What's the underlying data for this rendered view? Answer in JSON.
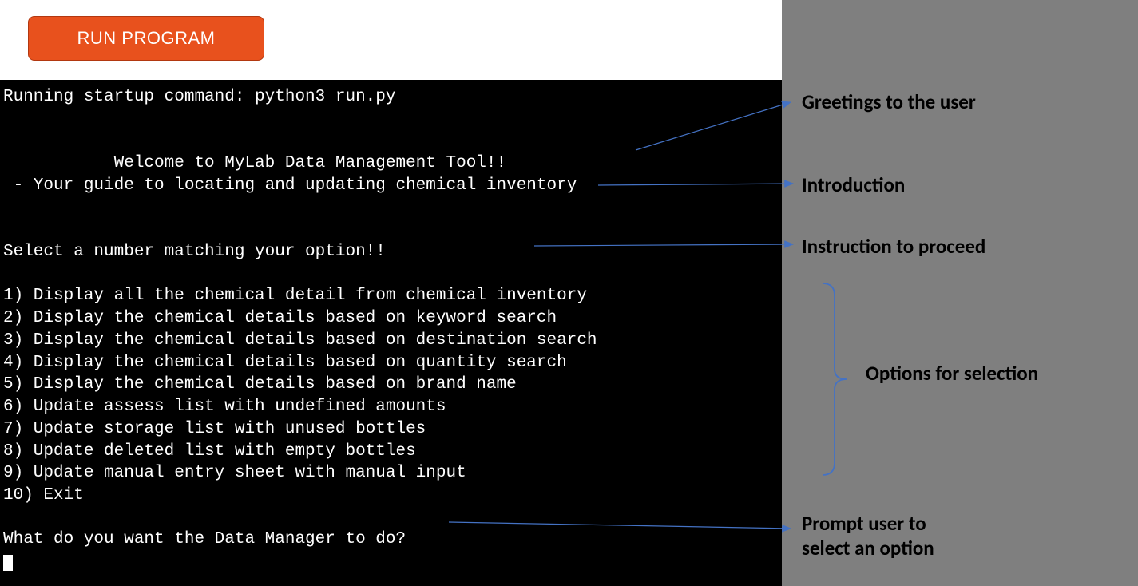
{
  "button": {
    "label": "RUN PROGRAM"
  },
  "terminal": {
    "startup": "Running startup command: python3 run.py",
    "welcome_indent": "           Welcome to MyLab Data Management Tool!!",
    "intro": " - Your guide to locating and updating chemical inventory",
    "instruction": "Select a number matching your option!!",
    "options": {
      "o1": "1) Display all the chemical detail from chemical inventory",
      "o2": "2) Display the chemical details based on keyword search",
      "o3": "3) Display the chemical details based on destination search",
      "o4": "4) Display the chemical details based on quantity search",
      "o5": "5) Display the chemical details based on brand name",
      "o6": "6) Update assess list with undefined amounts",
      "o7": "7) Update storage list with unused bottles",
      "o8": "8) Update deleted list with empty bottles",
      "o9": "9) Update manual entry sheet with manual input",
      "o10": "10) Exit"
    },
    "prompt": "What do you want the Data Manager to do?"
  },
  "annotations": {
    "greetings": "Greetings to the user",
    "introduction": "Introduction",
    "instruction": "Instruction to proceed",
    "options_label": "Options for selection",
    "prompt_label": "Prompt user to\nselect an option"
  },
  "colors": {
    "button_bg": "#e8511d",
    "terminal_bg": "#000000",
    "terminal_fg": "#ffffff",
    "panel_bg": "#7f7f7f",
    "arrow": "#4472c4"
  }
}
